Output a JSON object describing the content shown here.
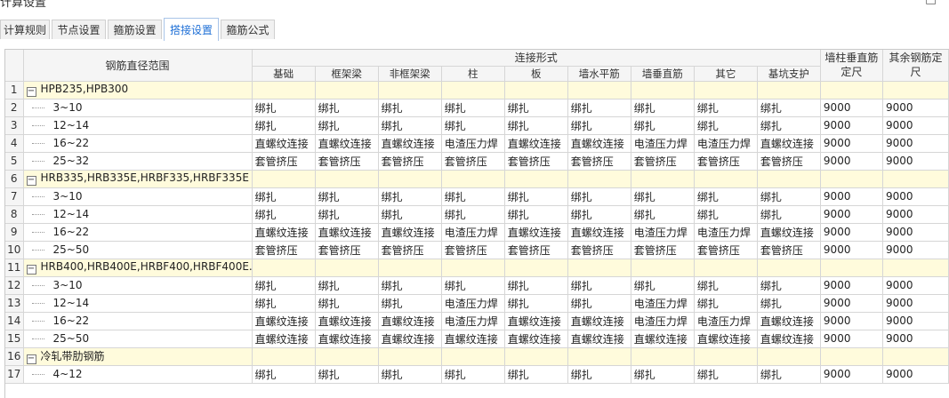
{
  "window": {
    "title": "计算设置",
    "minimize_glyph": "–",
    "maximize_glyph": "□"
  },
  "tabs": [
    {
      "label": "计算规则",
      "active": false
    },
    {
      "label": "节点设置",
      "active": false
    },
    {
      "label": "箍筋设置",
      "active": false
    },
    {
      "label": "搭接设置",
      "active": true
    },
    {
      "label": "箍筋公式",
      "active": false
    }
  ],
  "table": {
    "header": {
      "range_label": "钢筋直径范围",
      "group_label": "连接形式",
      "columns": [
        "基础",
        "框架梁",
        "非框架梁",
        "柱",
        "板",
        "墙水平筋",
        "墙垂直筋",
        "其它",
        "基坑支护"
      ],
      "wall_col_label": "墙柱垂直筋定尺",
      "other_col_label": "其余钢筋定尺"
    },
    "rows": [
      {
        "num": "1",
        "group": true,
        "label": "HPB235,HPB300"
      },
      {
        "num": "2",
        "group": false,
        "label": "3~10",
        "values": [
          "绑扎",
          "绑扎",
          "绑扎",
          "绑扎",
          "绑扎",
          "绑扎",
          "绑扎",
          "绑扎",
          "绑扎"
        ],
        "wall": "9000",
        "other": "9000"
      },
      {
        "num": "3",
        "group": false,
        "label": "12~14",
        "values": [
          "绑扎",
          "绑扎",
          "绑扎",
          "绑扎",
          "绑扎",
          "绑扎",
          "绑扎",
          "绑扎",
          "绑扎"
        ],
        "wall": "9000",
        "other": "9000"
      },
      {
        "num": "4",
        "group": false,
        "label": "16~22",
        "values": [
          "直螺纹连接",
          "直螺纹连接",
          "直螺纹连接",
          "电渣压力焊",
          "直螺纹连接",
          "直螺纹连接",
          "电渣压力焊",
          "电渣压力焊",
          "直螺纹连接"
        ],
        "wall": "9000",
        "other": "9000"
      },
      {
        "num": "5",
        "group": false,
        "label": "25~32",
        "values": [
          "套管挤压",
          "套管挤压",
          "套管挤压",
          "套管挤压",
          "套管挤压",
          "套管挤压",
          "套管挤压",
          "套管挤压",
          "套管挤压"
        ],
        "wall": "9000",
        "other": "9000"
      },
      {
        "num": "6",
        "group": true,
        "label": "HRB335,HRB335E,HRBF335,HRBF335E"
      },
      {
        "num": "7",
        "group": false,
        "label": "3~10",
        "values": [
          "绑扎",
          "绑扎",
          "绑扎",
          "绑扎",
          "绑扎",
          "绑扎",
          "绑扎",
          "绑扎",
          "绑扎"
        ],
        "wall": "9000",
        "other": "9000"
      },
      {
        "num": "8",
        "group": false,
        "label": "12~14",
        "values": [
          "绑扎",
          "绑扎",
          "绑扎",
          "绑扎",
          "绑扎",
          "绑扎",
          "绑扎",
          "绑扎",
          "绑扎"
        ],
        "wall": "9000",
        "other": "9000"
      },
      {
        "num": "9",
        "group": false,
        "label": "16~22",
        "values": [
          "直螺纹连接",
          "直螺纹连接",
          "直螺纹连接",
          "电渣压力焊",
          "直螺纹连接",
          "直螺纹连接",
          "电渣压力焊",
          "电渣压力焊",
          "直螺纹连接"
        ],
        "wall": "9000",
        "other": "9000"
      },
      {
        "num": "10",
        "group": false,
        "label": "25~50",
        "values": [
          "套管挤压",
          "套管挤压",
          "套管挤压",
          "套管挤压",
          "套管挤压",
          "套管挤压",
          "套管挤压",
          "套管挤压",
          "套管挤压"
        ],
        "wall": "9000",
        "other": "9000"
      },
      {
        "num": "11",
        "group": true,
        "label": "HRB400,HRB400E,HRBF400,HRBF400E..."
      },
      {
        "num": "12",
        "group": false,
        "label": "3~10",
        "values": [
          "绑扎",
          "绑扎",
          "绑扎",
          "绑扎",
          "绑扎",
          "绑扎",
          "绑扎",
          "绑扎",
          "绑扎"
        ],
        "wall": "9000",
        "other": "9000"
      },
      {
        "num": "13",
        "group": false,
        "label": "12~14",
        "values": [
          "绑扎",
          "绑扎",
          "绑扎",
          "电渣压力焊",
          "绑扎",
          "绑扎",
          "电渣压力焊",
          "绑扎",
          "绑扎"
        ],
        "wall": "9000",
        "other": "9000"
      },
      {
        "num": "14",
        "group": false,
        "label": "16~22",
        "values": [
          "直螺纹连接",
          "直螺纹连接",
          "直螺纹连接",
          "电渣压力焊",
          "直螺纹连接",
          "直螺纹连接",
          "电渣压力焊",
          "电渣压力焊",
          "直螺纹连接"
        ],
        "wall": "9000",
        "other": "9000"
      },
      {
        "num": "15",
        "group": false,
        "label": "25~50",
        "values": [
          "直螺纹连接",
          "直螺纹连接",
          "直螺纹连接",
          "直螺纹连接",
          "直螺纹连接",
          "直螺纹连接",
          "直螺纹连接",
          "直螺纹连接",
          "直螺纹连接"
        ],
        "wall": "9000",
        "other": "9000"
      },
      {
        "num": "16",
        "group": true,
        "label": "冷轧带肋钢筋"
      },
      {
        "num": "17",
        "group": false,
        "label": "4~12",
        "values": [
          "绑扎",
          "绑扎",
          "绑扎",
          "绑扎",
          "绑扎",
          "绑扎",
          "绑扎",
          "绑扎",
          "绑扎"
        ],
        "wall": "9000",
        "other": "9000"
      }
    ]
  }
}
